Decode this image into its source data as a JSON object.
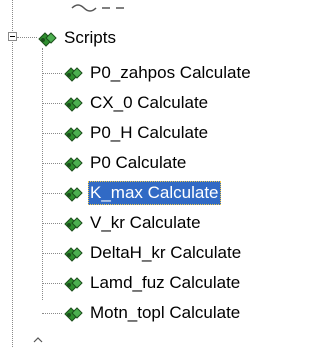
{
  "tree": {
    "parent": {
      "label": "Scripts",
      "expanded": true,
      "icon": "script-tree-icon"
    },
    "items": [
      {
        "label": "P0_zahpos Calculate",
        "selected": false
      },
      {
        "label": "CX_0 Calculate",
        "selected": false
      },
      {
        "label": "P0_H Calculate",
        "selected": false
      },
      {
        "label": "P0 Calculate",
        "selected": false
      },
      {
        "label": "K_max Calculate",
        "selected": true
      },
      {
        "label": "V_kr Calculate",
        "selected": false
      },
      {
        "label": "DeltaH_kr Calculate",
        "selected": false
      },
      {
        "label": "Lamd_fuz Calculate",
        "selected": false
      },
      {
        "label": "Motn_topl Calculate",
        "selected": false
      }
    ],
    "colors": {
      "selection": "#316ac5",
      "icon_green": "#2f8f2f",
      "icon_dark": "#1b4f1b"
    }
  }
}
